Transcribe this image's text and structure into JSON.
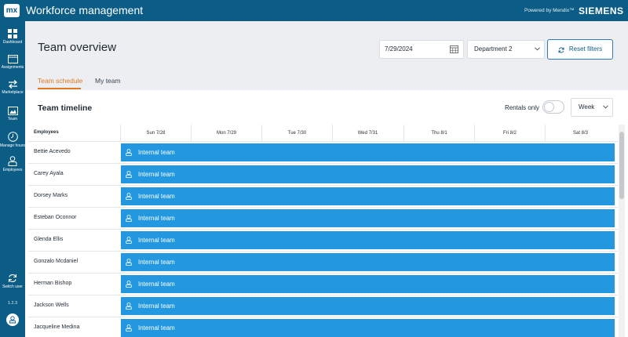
{
  "topbar": {
    "logo_text": "mx",
    "app_title": "Workforce management",
    "powered_by": "Powered by Mendix™",
    "brand": "SIEMENS"
  },
  "sidebar": {
    "items": [
      {
        "label": "Dashboard",
        "icon": "dashboard-icon"
      },
      {
        "label": "Assignments",
        "icon": "assignments-icon"
      },
      {
        "label": "Marketplace",
        "icon": "marketplace-icon"
      },
      {
        "label": "Team",
        "icon": "team-icon"
      },
      {
        "label": "Manage hours",
        "icon": "clock-icon"
      },
      {
        "label": "Employees",
        "icon": "employees-icon"
      }
    ],
    "switch_user": "Switch user",
    "version": "1.2.3"
  },
  "header": {
    "title": "Team overview",
    "date_value": "7/29/2024",
    "department_value": "Department 2",
    "reset_label": "Reset filters",
    "tabs": [
      {
        "label": "Team schedule",
        "active": true
      },
      {
        "label": "My team",
        "active": false
      }
    ]
  },
  "timeline": {
    "title": "Team timeline",
    "rentals_label": "Rentals only",
    "rentals_on": false,
    "view_value": "Week",
    "employees_header": "Employees",
    "days": [
      "Sun 7/28",
      "Mon 7/29",
      "Tue 7/30",
      "Wed 7/31",
      "Thu 8/1",
      "Fri 8/2",
      "Sat 8/3"
    ],
    "rows": [
      {
        "name": "Bettie Acevedo",
        "assignment": "Internal team"
      },
      {
        "name": "Carey Ayala",
        "assignment": "Internal team"
      },
      {
        "name": "Dorsey Marks",
        "assignment": "Internal team"
      },
      {
        "name": "Esteban Oconnor",
        "assignment": "Internal team"
      },
      {
        "name": "Glenda Ellis",
        "assignment": "Internal team"
      },
      {
        "name": "Gonzalo Mcdaniel",
        "assignment": "Internal team"
      },
      {
        "name": "Herman Bishop",
        "assignment": "Internal team"
      },
      {
        "name": "Jackson Wells",
        "assignment": "Internal team"
      },
      {
        "name": "Jacqueline Medina",
        "assignment": "Internal team"
      }
    ]
  },
  "colors": {
    "brand_blue": "#0b5d86",
    "bar_blue": "#2398e0",
    "accent_orange": "#e07b24"
  }
}
